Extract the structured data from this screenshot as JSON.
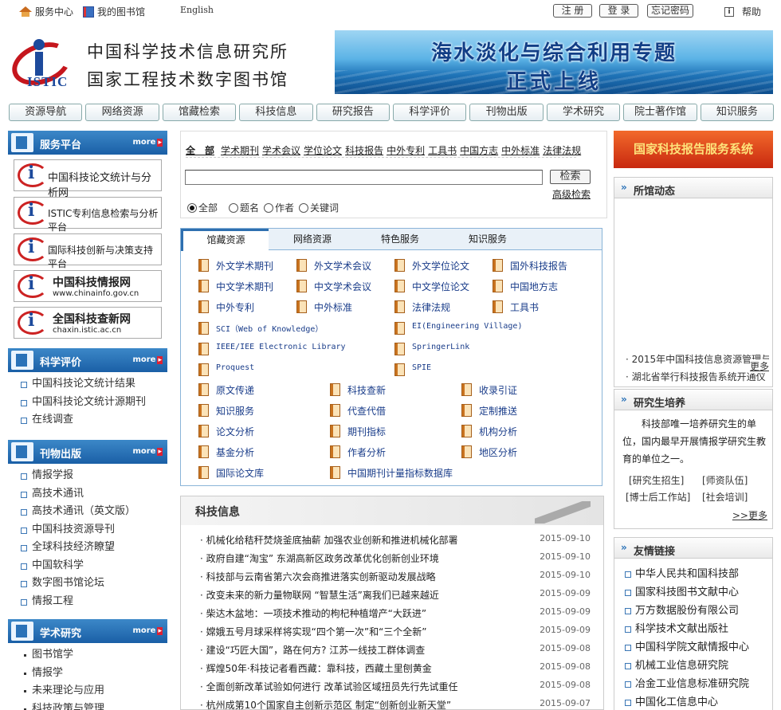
{
  "topbar": {
    "service": "服务中心",
    "mylib": "我的图书馆",
    "english": "English",
    "register": "注 册",
    "login": "登 录",
    "forgot": "忘记密码",
    "help": "帮助"
  },
  "header": {
    "org1": "中国科学技术信息研究所",
    "org2": "国家工程技术数字图书馆",
    "logo_text": "ISTIC",
    "banner_l1": "海水淡化与综合利用专题",
    "banner_l2": "正式上线"
  },
  "nav": [
    "资源导航",
    "网络资源",
    "馆藏检索",
    "科技信息",
    "研究报告",
    "科学评价",
    "刊物出版",
    "学术研究",
    "院士著作馆",
    "知识服务"
  ],
  "left": {
    "service": {
      "title": "服务平台",
      "more": "more",
      "items": [
        "中国科技论文统计与分析网",
        "ISTIC专利信息检索与分析平台",
        "国际科技创新与决策支持平台",
        "中国科技情报网",
        "全国科技查新网"
      ],
      "sub": [
        "www.chinainfo.gov.cn",
        "chaxin.istic.ac.cn"
      ]
    },
    "eval": {
      "title": "科学评价",
      "more": "more",
      "items": [
        "中国科技论文统计结果",
        "中国科技论文统计源期刊",
        "在线调查"
      ]
    },
    "pub": {
      "title": "刊物出版",
      "more": "more",
      "items": [
        "情报学报",
        "高技术通讯",
        "高技术通讯（英文版）",
        "中国科技资源导刊",
        "全球科技经济瞭望",
        "中国软科学",
        "数字图书馆论坛",
        "情报工程"
      ]
    },
    "research": {
      "title": "学术研究",
      "more": "more",
      "items": [
        "图书馆学",
        "情报学",
        "未来理论与应用",
        "科技政策与管理"
      ]
    }
  },
  "search": {
    "tabs": [
      "全　部",
      "学术期刊",
      "学术会议",
      "学位论文",
      "科技报告",
      "中外专利",
      "工具书",
      "中国方志",
      "中外标准",
      "法律法规"
    ],
    "button": "检索",
    "advanced": "高级检索",
    "radios": [
      "全部",
      "题名",
      "作者",
      "关键词"
    ]
  },
  "restabs": [
    "馆藏资源",
    "网络资源",
    "特色服务",
    "知识服务"
  ],
  "resources": {
    "row1": [
      "外文学术期刊",
      "外文学术会议",
      "外文学位论文",
      "国外科技报告"
    ],
    "row2": [
      "中文学术期刊",
      "中文学术会议",
      "中文学位论文",
      "中国地方志"
    ],
    "row3": [
      "中外专利",
      "中外标准",
      "法律法规",
      "工具书"
    ],
    "db": [
      "SCI（Web of Knowledge）",
      "EI(Engineering Village)",
      "IEEE/IEE Electronic Library",
      "SpringerLink",
      "Proquest",
      "SPIE"
    ],
    "svc1": [
      "原文传递",
      "科技查新",
      "收录引证"
    ],
    "svc2": [
      "知识服务",
      "代查代借",
      "定制推送"
    ],
    "svc3": [
      "论文分析",
      "期刊指标",
      "机构分析"
    ],
    "svc4": [
      "基金分析",
      "作者分析",
      "地区分析"
    ],
    "svc5": [
      "国际论文库",
      "中国期刊计量指标数据库"
    ]
  },
  "news": {
    "title": "科技信息",
    "items": [
      {
        "t": "· 机械化给秸秆焚烧釜底抽薪 加强农业创新和推进机械化部署",
        "d": "2015-09-10"
      },
      {
        "t": "· 政府自建“淘宝” 东湖高新区政务改革优化创新创业环境",
        "d": "2015-09-10"
      },
      {
        "t": "· 科技部与云南省第六次会商推进落实创新驱动发展战略",
        "d": "2015-09-10"
      },
      {
        "t": "· 改变未来的新力量物联网 “智慧生活”离我们已越来越近",
        "d": "2015-09-09"
      },
      {
        "t": "· 柴达木盆地：一项技术推动的枸杞种植增产“大跃进”",
        "d": "2015-09-09"
      },
      {
        "t": "· 嫦娥五号月球采样将实现“四个第一次”和“三个全新”",
        "d": "2015-09-09"
      },
      {
        "t": "· 建设“巧匠大国”，路在何方? 江苏一线技工群体调查",
        "d": "2015-09-08"
      },
      {
        "t": "· 辉煌50年·科技记者看西藏：靠科技，西藏土里刨黄金",
        "d": "2015-09-08"
      },
      {
        "t": "· 全面创新改革试验如何进行 改革试验区域扭员先行先试重任",
        "d": "2015-09-08"
      },
      {
        "t": "· 杭州成第10个国家自主创新示范区 制定“创新创业新天堂”",
        "d": "2015-09-07"
      }
    ]
  },
  "right": {
    "banner": "国家科技报告服务系统",
    "dyn": {
      "title": "所馆动态",
      "items": [
        "· 2015年中国科技信息资源管理与",
        "· 湖北省举行科技报告系统开通仪"
      ],
      "more": "更多"
    },
    "grad": {
      "title": "研究生培养",
      "desc": "科技部唯一培养研究生的单位，国内最早开展情报学研究生教育的单位之一。",
      "links": [
        "[研究生招生]",
        "[师资队伍]",
        "[博士后工作站]",
        "[社会培训]"
      ],
      "more": ">>更多"
    },
    "links": {
      "title": "友情链接",
      "items": [
        "中华人民共和国科技部",
        "国家科技图书文献中心",
        "万方数据股份有限公司",
        "科学技术文献出版社",
        "中国科学院文献情报中心",
        "机械工业信息研究院",
        "冶金工业信息标准研究院",
        "中国化工信息中心"
      ]
    }
  }
}
